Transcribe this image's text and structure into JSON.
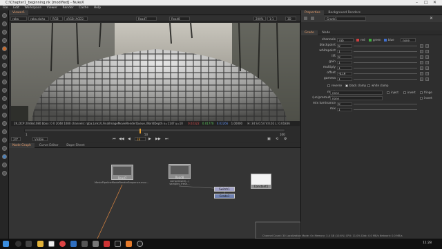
{
  "window": {
    "title": "C:\\Chapter1_beginning.nk [modified] - NukeX"
  },
  "menu": [
    "File",
    "Edit",
    "Workspace",
    "Viewer",
    "Render",
    "Cache",
    "Help"
  ],
  "viewer": {
    "tab_label": "Viewer1",
    "channel_set": "rgba",
    "alpha": "rgba.alpha",
    "colorspace": "RGB",
    "display": "sRGB (ACES)",
    "input_a": "Read7",
    "input_b": "Read8",
    "zoom": "200%",
    "proxy": "1:1",
    "view_mode": "3D",
    "info_bar": "2K_DCP 2048x1080  bbox: 0 0 2048 1080 channels: rgba;LinkUI_FinalImageMovieRenderQueue_WorldDepth  x=1147 y=10",
    "info_values": [
      "0.02322",
      "0.01770",
      "0.02266",
      "1.00000"
    ],
    "hsv": "H: 34 S:0.54 V:0.02 L: 0.01836",
    "frame": "28",
    "fps": "24*",
    "visible": "Visible",
    "frame_start": "1",
    "frame_mid": "50",
    "frame_end": "100"
  },
  "nodegraph": {
    "tabs": [
      "Node Graph",
      "Curve Editor",
      "Dope Sheet"
    ],
    "nodes": {
      "read7": {
        "name": "Read7",
        "caption": "MoviePipelineMovieRenderSequence.mov..."
      },
      "read8": {
        "name": "Read8",
        "caption": "compressed(...)\nsamples_fresh..."
      },
      "shuffle": {
        "name": "Switch1"
      },
      "grade": {
        "name": "Grade1"
      },
      "constant": {
        "name": "Constant1"
      }
    }
  },
  "properties": {
    "tabs": [
      "Properties",
      "Background Renders"
    ],
    "node_name": "Grade1",
    "subtabs": [
      "Grade",
      "Node"
    ],
    "channels_label": "channels",
    "channels_value": "rgb",
    "channel_checks": [
      "red",
      "green",
      "blue",
      "none"
    ],
    "rows": [
      {
        "label": "blackpoint",
        "value": "0"
      },
      {
        "label": "whitepoint",
        "value": "1"
      },
      {
        "label": "lift",
        "value": "0"
      },
      {
        "label": "gain",
        "value": "1"
      },
      {
        "label": "multiply",
        "value": "1"
      },
      {
        "label": "offset",
        "value": "-0.19"
      },
      {
        "label": "gamma",
        "value": "1"
      }
    ],
    "options": {
      "reverse": "reverse",
      "black_clamp": "black clamp",
      "white_clamp": "white clamp"
    },
    "mask_label": "mask",
    "mask_value": "none",
    "inject": "inject",
    "invert": "invert",
    "fringe": "fringe",
    "unpremult_label": "(un)premult by",
    "unpremult_value": "none",
    "mix_lum_label": "mix luminance",
    "mix_lum_value": "0",
    "mix_label": "mix",
    "mix_value": "1"
  },
  "statusbar": "Channel Count: 30  Localization Mode: On  Memory: 3.4 GB (10.6%)  CPU: 11.0%  Disk: 0.0 MB/s  Network: 0.0 MB/s",
  "taskbar": {
    "time": "11:28",
    "icons": [
      "windows-logo",
      "search",
      "task-view",
      "explorer",
      "chrome",
      "nuke",
      "app-red",
      "app-dark",
      "app-orange",
      "app-blue",
      "app-gray"
    ]
  }
}
